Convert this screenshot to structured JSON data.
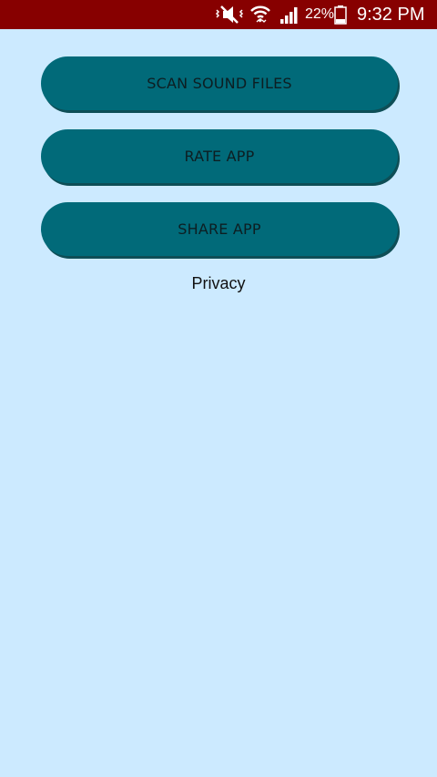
{
  "status_bar": {
    "background": "#870000",
    "icons": [
      "mute-icon",
      "wifi-icon",
      "signal-icon",
      "battery-icon"
    ],
    "battery_percent": "22%",
    "time": "9:32 PM"
  },
  "main": {
    "background": "#cceaff",
    "button_color": "#016a79",
    "buttons": [
      {
        "label": "SCAN SOUND FILES"
      },
      {
        "label": "RATE APP"
      },
      {
        "label": "SHARE APP"
      }
    ],
    "privacy_label": "Privacy"
  }
}
